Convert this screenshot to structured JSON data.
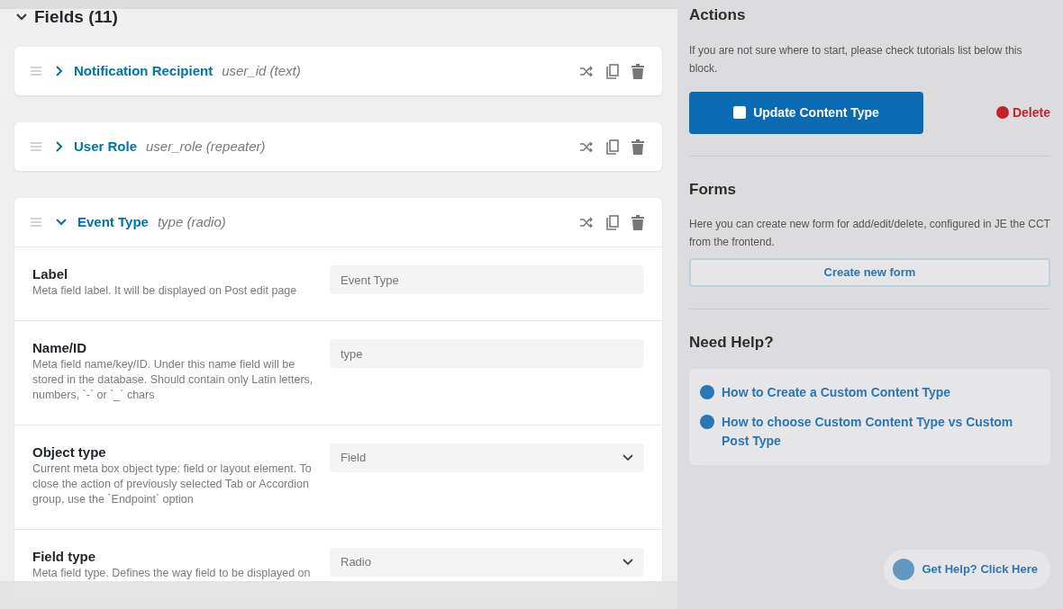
{
  "section": {
    "title": "Fields (11)",
    "expanded": true
  },
  "fields": [
    {
      "label": "Notification Recipient",
      "meta": "user_id (text)",
      "expanded": false
    },
    {
      "label": "User Role",
      "meta": "user_role (repeater)",
      "expanded": false
    },
    {
      "label": "Event Type",
      "meta": "type (radio)",
      "expanded": true,
      "settings": [
        {
          "kind": "input",
          "label": "Label",
          "description": "Meta field label. It will be displayed on Post edit page",
          "value": "Event Type"
        },
        {
          "kind": "input",
          "label": "Name/ID",
          "description": "Meta field name/key/ID. Under this name field will be stored in the database. Should contain only Latin letters, numbers, `-` or `_` chars",
          "value": "type"
        },
        {
          "kind": "select",
          "label": "Object type",
          "description": "Current meta box object type: field or layout element. To close the action of previously selected Tab or Accordion group, use the `Endpoint` option",
          "value": "Field"
        },
        {
          "kind": "select",
          "label": "Field type",
          "description": "Meta field type. Defines the way field to be displayed on",
          "value": "Radio"
        }
      ]
    }
  ],
  "sidebar": {
    "actions": {
      "title": "Actions",
      "text": "If you are not sure where to start, please check tutorials list below this block.",
      "update_button": "Update Content Type",
      "delete_link": "Delete"
    },
    "forms": {
      "title": "Forms",
      "text": "Here you can create new form for add/edit/delete, configured in JE the CCT from the frontend.",
      "button": "Create new form"
    },
    "help": {
      "title": "Need Help?",
      "links": [
        "How to Create a Custom Content Type",
        "How to choose Custom Content Type vs Custom Post Type"
      ]
    },
    "help_button": "Get Help? Click Here"
  }
}
